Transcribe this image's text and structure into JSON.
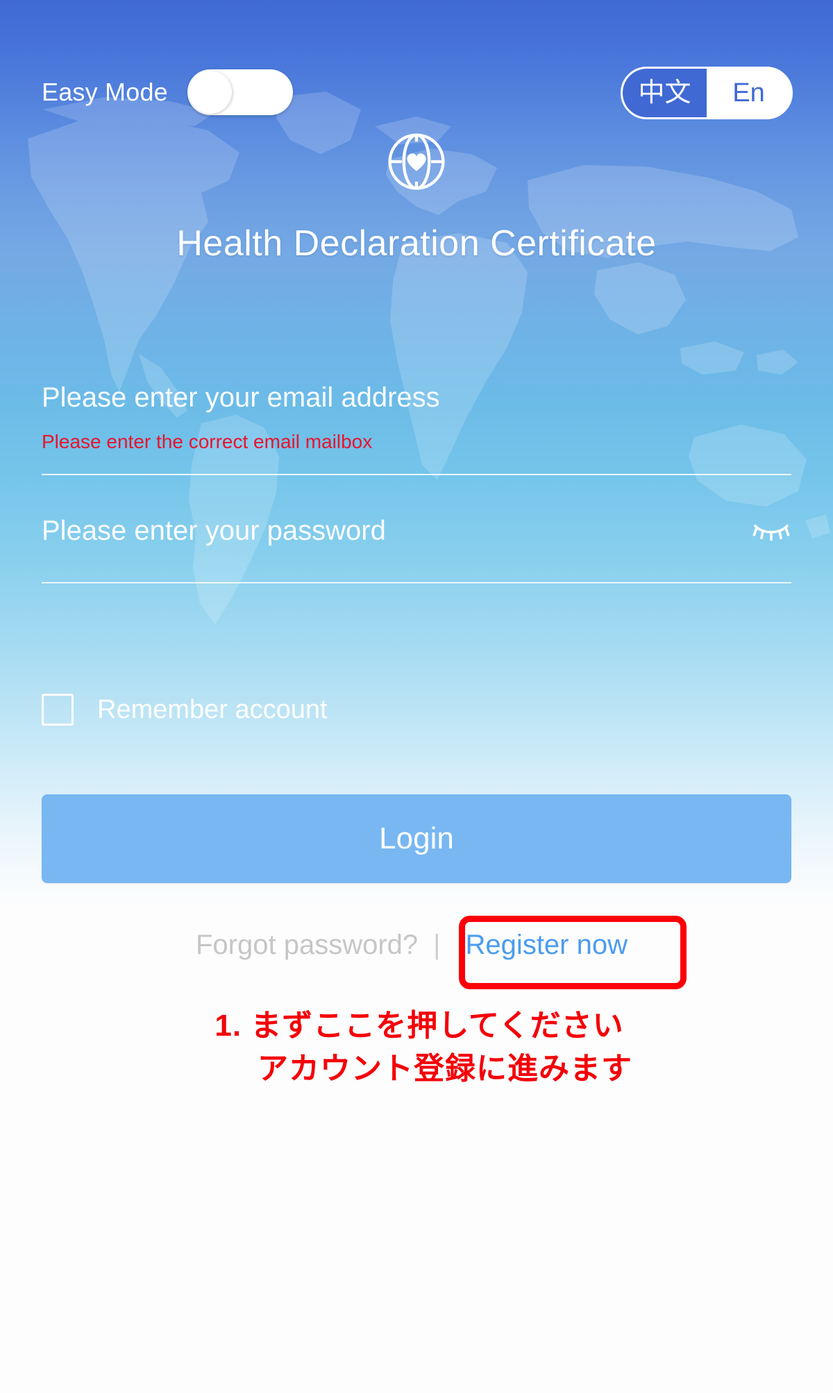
{
  "header": {
    "easy_mode_label": "Easy Mode",
    "easy_mode_state": "off",
    "lang_chinese": "中文",
    "lang_english": "En",
    "lang_selected": "En"
  },
  "brand": {
    "logo_icon": "globe-heart-icon",
    "app_title": "Health Declaration Certificate"
  },
  "form": {
    "email": {
      "value": "",
      "placeholder": "Please enter your email address",
      "error": "Please enter the correct email mailbox"
    },
    "password": {
      "value": "",
      "placeholder": "Please enter your password",
      "visibility_icon": "eye-closed-icon"
    },
    "remember": {
      "label": "Remember account",
      "checked": false
    },
    "login_label": "Login"
  },
  "links": {
    "forgot_password": "Forgot password?",
    "separator": "|",
    "register_now": "Register now"
  },
  "annotation": {
    "line1": "1.  まずここを押してください",
    "line2": "アカウント登録に進みます",
    "highlight_color": "#fb0007",
    "text_color": "#f40008"
  },
  "colors": {
    "top_blue": "#4069d4",
    "mid_blue": "#6cbbe8",
    "bottom_white": "#fdfdfd",
    "login_button": "#78b7f2",
    "register_link": "#4a9cf0",
    "error_red": "#e8142d",
    "forgot_gray": "#c6c6c6"
  }
}
